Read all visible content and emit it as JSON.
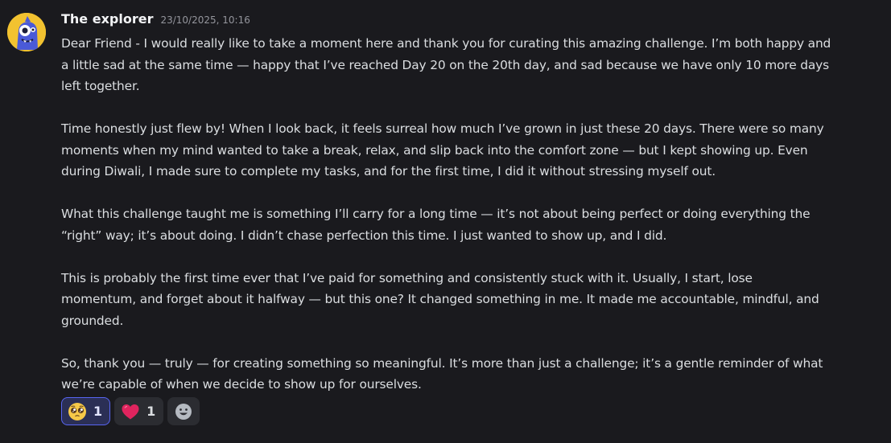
{
  "message": {
    "author": "The explorer",
    "timestamp": "23/10/2025, 10:16",
    "paragraphs": [
      [
        "Dear Friend - I would really like to take a moment here and thank you for curating this amazing challenge. I’m both happy and",
        "a little sad at the same time — happy that I’ve reached Day 20 on the 20th day, and sad because we have only 10 more days",
        "left together."
      ],
      [
        "Time honestly just flew by! When I look back, it feels surreal how much I’ve grown in just these 20 days. There were so many",
        "moments when my mind wanted to take a break, relax, and slip back into the comfort zone — but I kept showing up. Even",
        "during Diwali, I made sure to complete my tasks, and for the first time, I did it without stressing myself out."
      ],
      [
        "What this challenge taught me is something I’ll carry for a long time — it’s not about being perfect or doing everything the",
        "“right” way; it’s about doing. I didn’t chase perfection this time. I just wanted to show up, and I did."
      ],
      [
        "This is probably the first time ever that I’ve paid for something and consistently stuck with it. Usually, I start, lose",
        "momentum, and forget about it halfway — but this one? It changed something in me. It made me accountable, mindful, and",
        "grounded."
      ],
      [
        "So, thank you — truly — for creating something so meaningful. It’s more than just a challenge; it’s a gentle reminder of what",
        "we’re capable of when we decide to show up for ourselves."
      ]
    ]
  },
  "reactions": [
    {
      "icon": "pleading-face-emoji-icon",
      "count": "1",
      "active": true
    },
    {
      "icon": "red-heart-emoji-icon",
      "count": "1",
      "active": false
    }
  ],
  "add_reaction": {
    "icon": "add-reaction-smiley-icon"
  },
  "colors": {
    "background": "#1a1a1e",
    "text": "#dbdee1",
    "username": "#f2f3f5",
    "timestamp": "#94959c",
    "reaction_bg": "#2b2c31",
    "reaction_active_bg": "#2b2f55",
    "reaction_active_border": "#5865f2",
    "avatar_bg": "#f2c230"
  }
}
